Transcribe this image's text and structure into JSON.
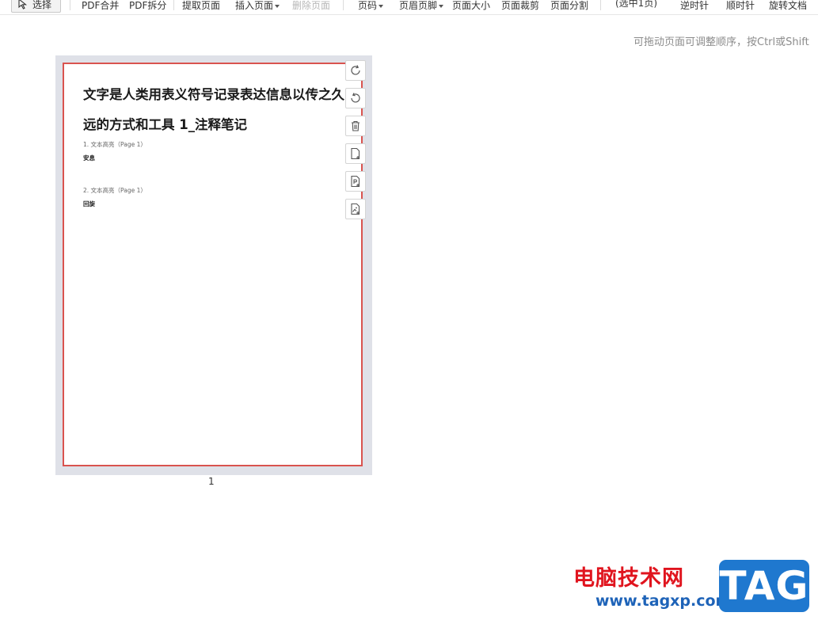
{
  "toolbar": {
    "select": "选择",
    "pdf_merge": "PDF合并",
    "pdf_split": "PDF拆分",
    "extract_page": "提取页面",
    "insert_page": "插入页面",
    "delete_page": "删除页面",
    "page_number": "页码",
    "header_footer": "页眉页脚",
    "page_size": "页面大小",
    "page_crop": "页面裁剪",
    "page_split": "页面分割",
    "selected_count": "(选中1页)",
    "counterclockwise": "逆时针",
    "clockwise": "顺时针",
    "rotate_doc": "旋转文档"
  },
  "hint": "可拖动页面可调整顺序，按Ctrl或Shift",
  "page": {
    "title": "文字是人类用表义符号记录表达信息以传之久远的方式和工具 1_注释笔记",
    "notes": [
      {
        "head": "1. 文本高亮（Page 1）",
        "body": "安息"
      },
      {
        "head": "2. 文本高亮（Page 1）",
        "body": "回旋"
      }
    ],
    "number": "1"
  },
  "side_tools": [
    "rotate-clockwise-icon",
    "rotate-counterclockwise-icon",
    "delete-icon",
    "add-blank-page-icon",
    "insert-pdf-page-icon",
    "insert-image-page-icon"
  ],
  "watermark": {
    "site_name": "电脑技术网",
    "url": "www.tagxp.com",
    "tag": "TAG"
  },
  "colors": {
    "selected_border": "#d9534f",
    "page_panel": "#dfe1e8",
    "watermark_red": "#e0141e",
    "watermark_blue": "#1f78cf"
  }
}
